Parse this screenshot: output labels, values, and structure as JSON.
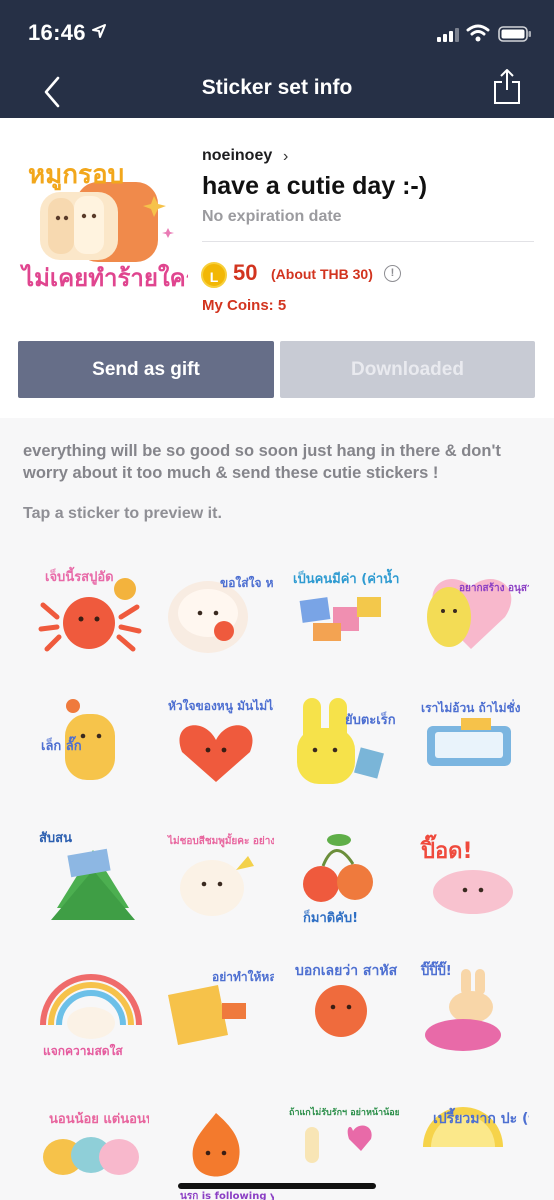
{
  "status_bar": {
    "time": "16:46"
  },
  "header": {
    "title": "Sticker set info"
  },
  "sticker_set": {
    "author": "noeinoey",
    "title": "have a cutie day :-)",
    "expiry": "No expiration date",
    "cover_text_top": "หมูกรอบ",
    "cover_text_bottom": "ไม่เคยทำร้ายใคร",
    "coin_badge": "L",
    "price": "50",
    "price_about": "(About THB 30)",
    "my_coins": "My Coins: 5"
  },
  "actions": {
    "gift_label": "Send as gift",
    "download_label": "Downloaded"
  },
  "description": "everything will be so good so soon just hang in there & don't worry about it too much & send these cutie stickers !",
  "preview_hint": "Tap a sticker to preview it.",
  "stickers": [
    {
      "text": "เจ็บนี้รสปูอัด"
    },
    {
      "text": "ขอใส่ใจ หน่อย"
    },
    {
      "text": "เป็นคนมีค่า (ค่าน้ำ ค่าไฟ)"
    },
    {
      "text": "อยากสร้าง อนุสาวรีย์ ค่าตั้งเธอ"
    },
    {
      "text": "เล็ก ลั๊ก"
    },
    {
      "text": "หัวใจของหนู มันไม่ได้เป็น ของหนูอีกต่อไป"
    },
    {
      "text": "ยับตะเร็ก"
    },
    {
      "text": "เราไม่อ้วน ถ้าไม่ชั่ง"
    },
    {
      "text": "สับสน"
    },
    {
      "text": "ไม่ชอบสีชมพูมั้ยคะ อย่างเช่น หนู"
    },
    {
      "text": "ก็มาดิคับ!"
    },
    {
      "text": "ปิ๊อด!"
    },
    {
      "text": "แจกความสดใส"
    },
    {
      "text": "อย่าทำให้หลง ด้วยการ สังโลกซึมนาน"
    },
    {
      "text": "บอกเลยว่า สาหัส"
    },
    {
      "text": "ปิ๊ปิ๊ปิ๊!"
    },
    {
      "text": "นอนน้อย แต่นอนนะ"
    },
    {
      "text": "นรก is following you"
    },
    {
      "text": "ถ้าแกไม่รับรักฯ อย่าหน้าน้อย ช่วยไม่รับลูก พลาดรักไม่ทัน"
    },
    {
      "text": "เปรี้ยวมาก ปะ (ทาโรลออนมั้ย)"
    }
  ],
  "colors": {
    "header_bg": "#263046",
    "price": "#d2341f",
    "gift_button": "#666e88",
    "download_button": "#c8cbd4"
  }
}
